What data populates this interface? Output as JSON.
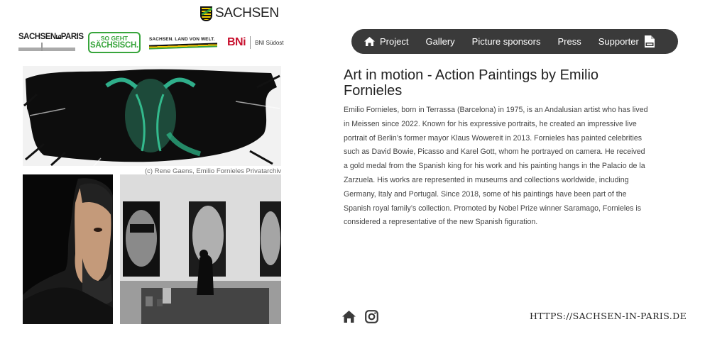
{
  "header": {
    "state_logo_text": "SACHSEN"
  },
  "partners": {
    "sachsen_in_paris": {
      "part1": "SACHSEN",
      "in": "IN",
      "part2": "PARIS"
    },
    "so_geht": {
      "line1": "SO GEHT",
      "line2": "SÄCHSISCH."
    },
    "land_von_welt": "SACHSEN. LAND VON WELT.",
    "bni": {
      "mark": "BNi",
      "sub": "BNI Südost"
    }
  },
  "nav": {
    "items": [
      {
        "label": "Project",
        "icon": "home-icon"
      },
      {
        "label": "Gallery"
      },
      {
        "label": "Picture sponsors"
      },
      {
        "label": "Press"
      },
      {
        "label": "Supporter"
      }
    ],
    "pdf_icon": "pdf-icon"
  },
  "artwork": {
    "caption": "(c) Rene Gaens, Emilio Fornieles Privatarchiv"
  },
  "article": {
    "title": "Art in motion - Action Paintings by Emilio Fornieles",
    "body": "Emilio Fornieles, born in Terrassa (Barcelona) in 1975, is an Andalusian artist who has lived in Meissen since 2022. Known for his expressive portraits, he created an impressive live portrait of Berlin’s former mayor Klaus Wowereit in 2013. Fornieles has painted celebrities such as David Bowie, Picasso and Karel Gott, whom he portrayed on camera. He received a gold medal from the Spanish king for his work and his painting hangs in the Palacio de la Zarzuela. His works are represented in museums and collections worldwide, including Germany, Italy and Portugal. Since 2018, some of his paintings have been part of the Spanish royal family’s collection. Promoted by Nobel Prize winner Saramago, Fornieles is considered a representative of the new Spanish figuration."
  },
  "footer": {
    "home_icon": "home-icon",
    "instagram_icon": "instagram-icon",
    "url": "HTTPS://SACHSEN-IN-PARIS.DE"
  },
  "colors": {
    "nav_bg": "#3a3a3a",
    "green_brand": "#38a53c",
    "bni_red": "#c8102e"
  }
}
